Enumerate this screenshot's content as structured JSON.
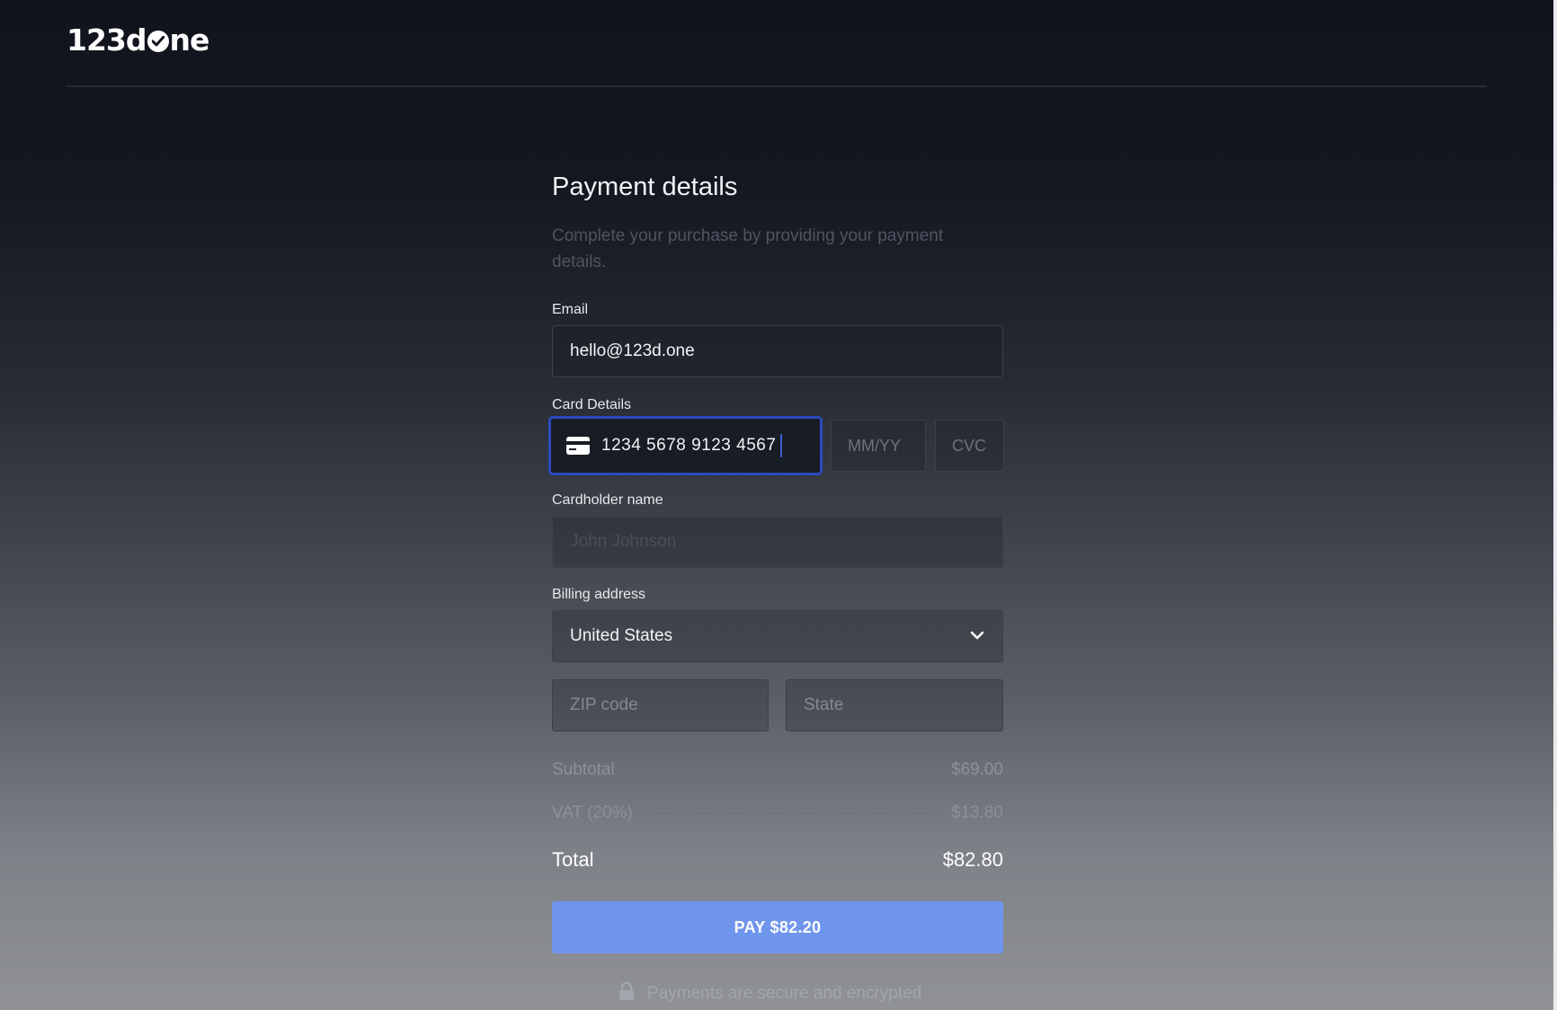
{
  "brand": {
    "logo_prefix": "123d",
    "logo_suffix": "ne"
  },
  "page": {
    "title": "Payment details",
    "subtitle": "Complete your purchase by providing your payment details."
  },
  "email": {
    "label": "Email",
    "value": "hello@123d.one"
  },
  "card": {
    "label": "Card Details",
    "number": "1234  5678  9123  4567",
    "expiry_placeholder": "MM/YY",
    "cvc_placeholder": "CVC",
    "icon": "credit-card-icon"
  },
  "cardholder": {
    "label": "Cardholder name",
    "placeholder": "John Johnson"
  },
  "billing": {
    "label": "Billing address",
    "country": "United States",
    "zip_placeholder": "ZIP code",
    "state_placeholder": "State"
  },
  "summary": {
    "subtotal_label": "Subtotal",
    "subtotal_value": "$69.00",
    "vat_label": "VAT (20%)",
    "vat_value": "$13.80",
    "total_label": "Total",
    "total_value": "$82.80"
  },
  "pay_button": {
    "label": "PAY $82.20"
  },
  "footer": {
    "secure_text": "Payments are secure and encrypted",
    "icon": "lock-icon"
  },
  "colors": {
    "accent": "#7095ec",
    "focus_border": "#2b4bbd",
    "background_top": "#11141c",
    "background_bottom": "#909297"
  }
}
